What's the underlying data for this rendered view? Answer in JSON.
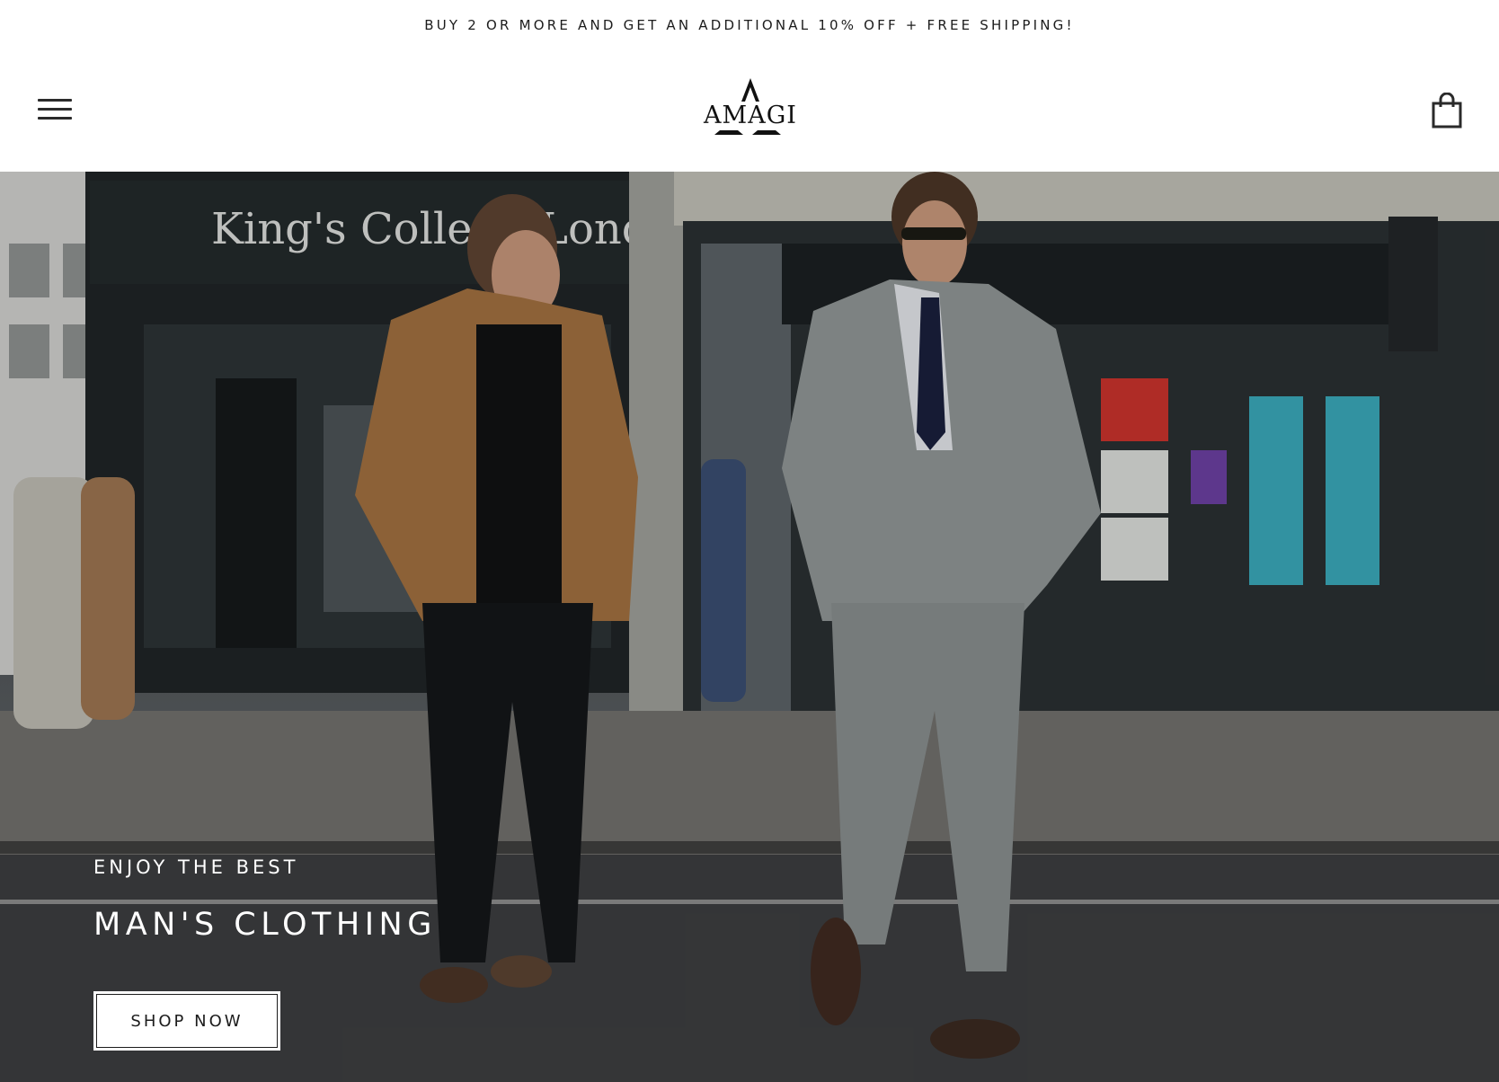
{
  "announcement": {
    "text": "BUY 2 OR MORE AND GET AN ADDITIONAL 10% OFF + FREE SHIPPING!"
  },
  "header": {
    "menu_icon": "hamburger-menu-icon",
    "logo_text": "AMAGI",
    "cart_icon": "shopping-bag-icon"
  },
  "hero": {
    "background_sign_left": "King's College London",
    "eyebrow": "ENJOY THE BEST",
    "title": "MAN'S CLOTHING",
    "cta_label": "SHOP NOW"
  },
  "colors": {
    "text_dark": "#1c1c1c",
    "header_bg": "#ffffff",
    "hero_text": "#ffffff",
    "jacket_tan": "#a06f3f",
    "suit_grey": "#8f9594"
  }
}
